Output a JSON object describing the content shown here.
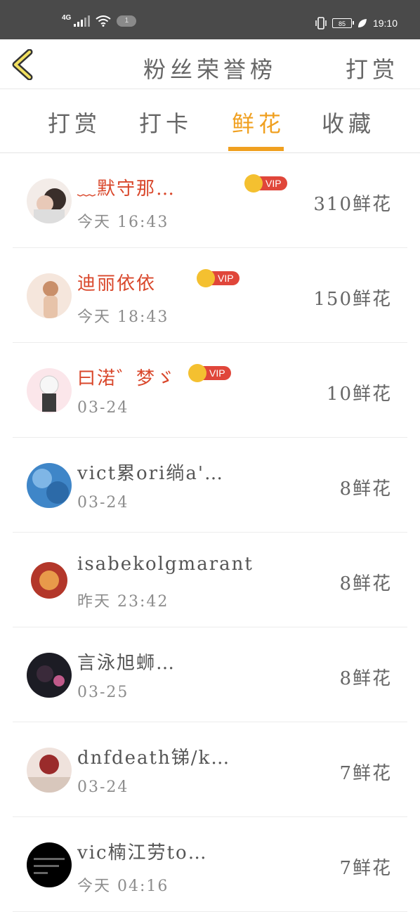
{
  "status_bar": {
    "network": "4G",
    "notification_count": "1",
    "battery": "85",
    "time": "19:10"
  },
  "header": {
    "title": "粉丝荣誉榜",
    "right_action": "打赏",
    "back_icon": "chevron-left-icon"
  },
  "tabs": [
    {
      "label": "打赏",
      "active": false
    },
    {
      "label": "打卡",
      "active": false
    },
    {
      "label": "鲜花",
      "active": true
    },
    {
      "label": "收藏",
      "active": false
    }
  ],
  "colors": {
    "accent": "#f0a020",
    "vip_name": "#d9472b",
    "vip_badge": "#e0463a"
  },
  "rows": [
    {
      "name": "﹏默守那…",
      "vip": true,
      "vip_label": "VIP",
      "time": "今天 16:43",
      "amount": "310鲜花"
    },
    {
      "name": "迪丽依依",
      "vip": true,
      "vip_label": "VIP",
      "time": "今天 18:43",
      "amount": "150鲜花"
    },
    {
      "name": "曰渃゛梦ゞ",
      "vip": true,
      "vip_label": "VIP",
      "time": "03-24",
      "amount": "10鲜花"
    },
    {
      "name": "vict累ori绱a'…",
      "vip": false,
      "time": "03-24",
      "amount": "8鲜花"
    },
    {
      "name": "isabekolgmarant",
      "vip": false,
      "time": "昨天 23:42",
      "amount": "8鲜花"
    },
    {
      "name": "言泳旭蛳…",
      "vip": false,
      "time": "03-25",
      "amount": "8鲜花"
    },
    {
      "name": "dnfdeath锑/k…",
      "vip": false,
      "time": "03-24",
      "amount": "7鲜花"
    },
    {
      "name": "vic楠江劳to…",
      "vip": false,
      "time": "今天 04:16",
      "amount": "7鲜花"
    }
  ]
}
